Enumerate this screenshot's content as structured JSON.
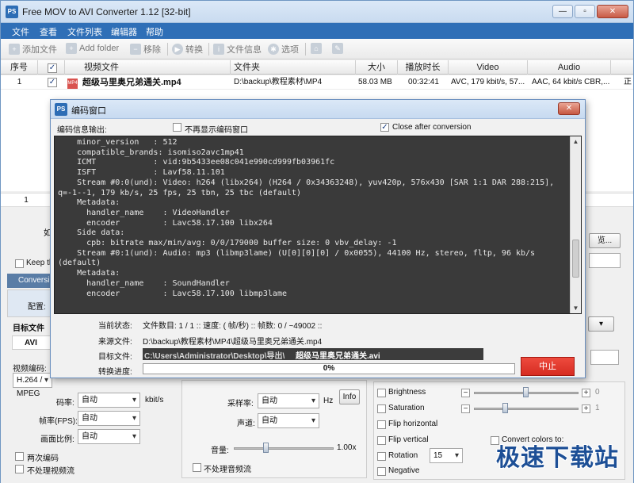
{
  "app": {
    "title": "Free MOV to AVI Converter 1.12  [32-bit]",
    "icon_text": "PS"
  },
  "window_buttons": {
    "minimize": "—",
    "maximize": "▫",
    "close": "✕"
  },
  "menu": [
    "文件",
    "查看",
    "文件列表",
    "编辑器",
    "帮助"
  ],
  "toolbar": {
    "add_file": "添加文件",
    "add_folder": "Add folder",
    "remove": "移除",
    "convert": "转换",
    "file_info": "文件信息",
    "options": "选项"
  },
  "file_table": {
    "headers": [
      "序号",
      "",
      "视频文件",
      "文件夹",
      "大小",
      "播放时长",
      "Video",
      "Audio"
    ],
    "rows": [
      {
        "index": "1",
        "file": "超级马里奥兄弟通关.mp4",
        "folder": "D:\\backup\\教程素材\\MP4",
        "size": "58.03 MB",
        "duration": "00:32:41",
        "video": "AVC, 179 kbit/s, 57...",
        "audio": "AAC, 64 kbit/s CBR,...",
        "extra": "正"
      }
    ],
    "footer_count": "1"
  },
  "lower_panel": {
    "keep_label": "Keep th",
    "convert_tab": "Conversi",
    "config_label": "配置:",
    "target_label": "目标文件",
    "format_tab": "AVI",
    "video_codec_label": "视频编码:",
    "video_codec_value": "H.264 / MPEG",
    "bitrate_label": "码率:",
    "bitrate_value": "自动",
    "bitrate_unit": "kbit/s",
    "fps_label": "帧率(FPS):",
    "fps_value": "自动",
    "aspect_label": "画面比例:",
    "aspect_value": "自动",
    "two_pass": "两次编码",
    "no_video": "不处理视频流",
    "samplerate_label": "采样率:",
    "samplerate_value": "自动",
    "samplerate_unit": "Hz",
    "info_btn": "Info",
    "channels_label": "声道:",
    "channels_value": "自动",
    "volume_label": "音量:",
    "volume_value": "1.00x",
    "no_audio": "不处理音频流",
    "brightness": "Brightness",
    "brightness_value": "0",
    "saturation": "Saturation",
    "saturation_value": "1",
    "flip_h": "Flip horizontal",
    "flip_v": "Flip vertical",
    "convert_colors": "Convert colors to:",
    "rotation": "Rotation",
    "rotation_value": "15",
    "negative": "Negative",
    "browse": "览..."
  },
  "dialog": {
    "title": "编码窗口",
    "output_label": "编码信息输出:",
    "hide_window": "不再显示编码窗口",
    "close_after": "Close after conversion",
    "close_after_checked": true,
    "console_lines": [
      "    minor_version   : 512",
      "    compatible_brands: isomiso2avc1mp41",
      "    ICMT            : vid:9b5433ee08c041e990cd999fb03961fc",
      "    ISFT            : Lavf58.11.101",
      "    Stream #0:0(und): Video: h264 (libx264) (H264 / 0x34363248), yuv420p, 576x430 [SAR 1:1 DAR 288:215], q=-1--1, 179 kb/s, 25 fps, 25 tbn, 25 tbc (default)",
      "    Metadata:",
      "      handler_name    : VideoHandler",
      "      encoder         : Lavc58.17.100 libx264",
      "    Side data:",
      "      cpb: bitrate max/min/avg: 0/0/179000 buffer size: 0 vbv_delay: -1",
      "    Stream #0:1(und): Audio: mp3 (libmp3lame) (U[0][0][0] / 0x0055), 44100 Hz, stereo, fltp, 96 kb/s (default)",
      "    Metadata:",
      "      handler_name    : SoundHandler",
      "      encoder         : Lavc58.17.100 libmp3lame"
    ],
    "status_label": "当前状态:",
    "status_value": "文件数目: 1 / 1  ::  速度: ( 帧/秒)  ::  帧数: 0 / ~49002  ::",
    "source_label": "来源文件:",
    "source_value": "D:\\backup\\教程素材\\MP4\\超级马里奥兄弟通关.mp4",
    "target_label": "目标文件:",
    "target_path": "C:\\Users\\Administrator\\Desktop\\导出\\",
    "target_name": "超级马里奥兄弟通关.avi",
    "progress_label": "转换进度:",
    "progress_text": "0%",
    "progress_fraction": 0,
    "stop_button": "中止"
  },
  "watermark": "极速下载站"
}
